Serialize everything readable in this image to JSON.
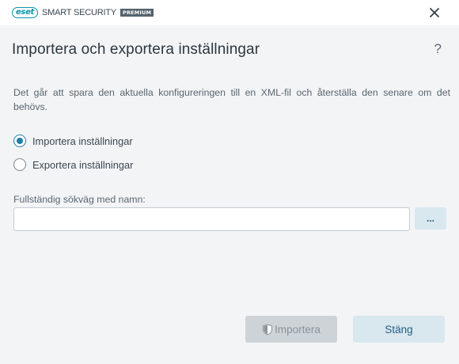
{
  "titlebar": {
    "logo_brand": "eset",
    "product_name": "SMART SECURITY",
    "edition_badge": "PREMIUM",
    "close_icon": "close-icon"
  },
  "dialog": {
    "title": "Importera och exportera inställningar",
    "help_label": "?",
    "description": "Det går att spara den aktuella konfigureringen till en XML-fil och återställa den senare om det behövs.",
    "options": [
      {
        "label": "Importera inställningar",
        "selected": true
      },
      {
        "label": "Exportera inställningar",
        "selected": false
      }
    ],
    "path": {
      "label": "Fullständig sökväg med namn:",
      "value": "",
      "placeholder": "",
      "browse_label": "..."
    }
  },
  "buttons": {
    "import_label": "Importera",
    "import_enabled": false,
    "close_label": "Stäng"
  },
  "colors": {
    "accent": "#1f7fa8",
    "brand": "#0f92a8",
    "button_blue_bg": "#d9e7ef",
    "button_disabled_bg": "#ced3d7"
  }
}
